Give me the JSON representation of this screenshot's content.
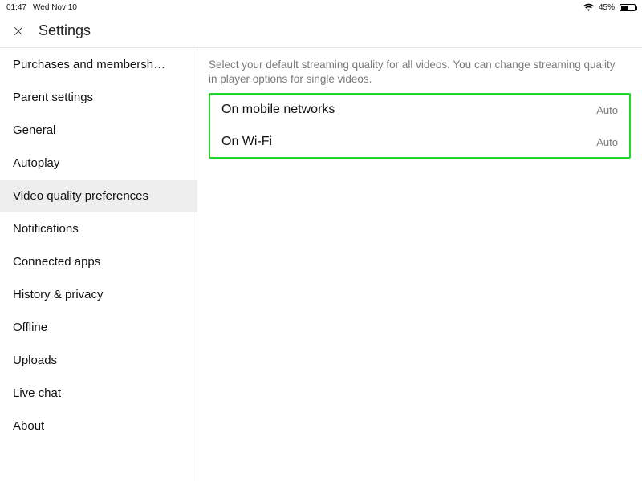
{
  "statusbar": {
    "time": "01:47",
    "date": "Wed Nov 10",
    "battery_pct": "45%"
  },
  "header": {
    "title": "Settings"
  },
  "sidebar": {
    "items": [
      {
        "label": "Purchases and membersh…"
      },
      {
        "label": "Parent settings"
      },
      {
        "label": "General"
      },
      {
        "label": "Autoplay"
      },
      {
        "label": "Video quality preferences"
      },
      {
        "label": "Notifications"
      },
      {
        "label": "Connected apps"
      },
      {
        "label": "History & privacy"
      },
      {
        "label": "Offline"
      },
      {
        "label": "Uploads"
      },
      {
        "label": "Live chat"
      },
      {
        "label": "About"
      }
    ],
    "selected_index": 4
  },
  "content": {
    "description": "Select your default streaming quality for all videos. You can change streaming quality in player options for single videos.",
    "rows": [
      {
        "label": "On mobile networks",
        "value": "Auto"
      },
      {
        "label": "On Wi-Fi",
        "value": "Auto"
      }
    ]
  }
}
